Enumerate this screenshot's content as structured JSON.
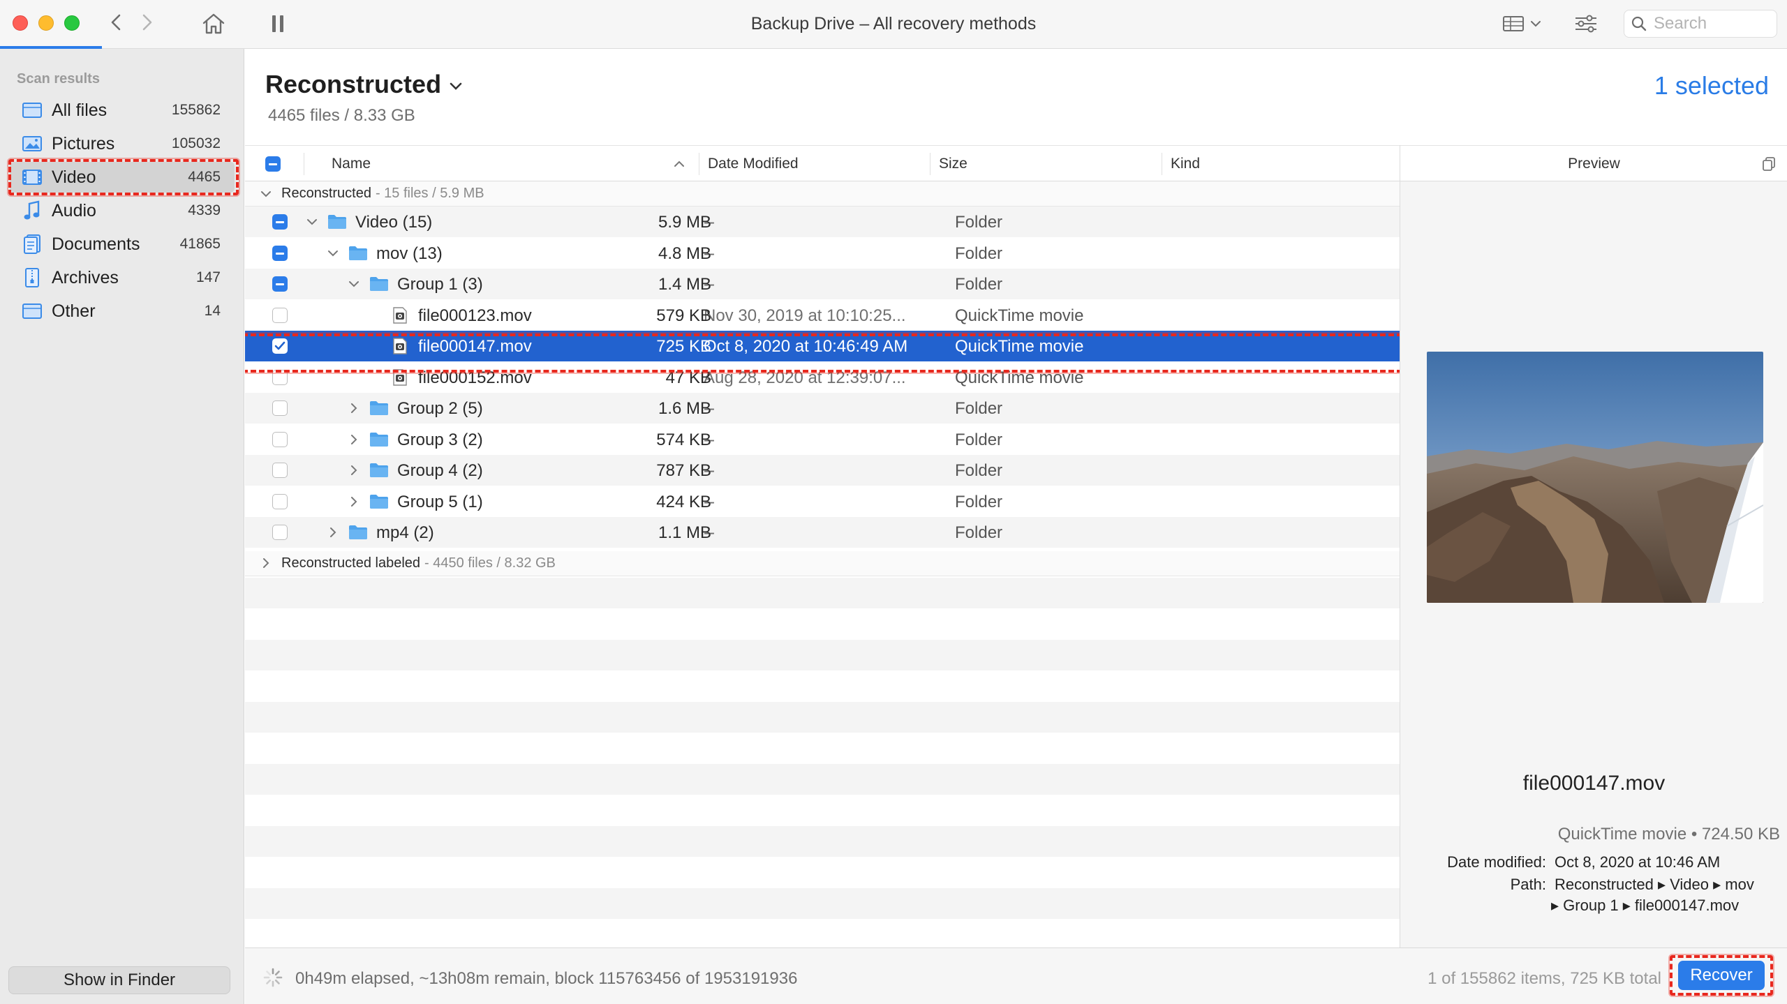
{
  "window": {
    "title": "Backup Drive – All recovery methods",
    "search_placeholder": "Search"
  },
  "sidebar": {
    "heading": "Scan results",
    "items": [
      {
        "label": "All files",
        "count": "155862",
        "icon": "all-files-icon"
      },
      {
        "label": "Pictures",
        "count": "105032",
        "icon": "pictures-icon"
      },
      {
        "label": "Video",
        "count": "4465",
        "icon": "video-icon",
        "active": true
      },
      {
        "label": "Audio",
        "count": "4339",
        "icon": "audio-icon"
      },
      {
        "label": "Documents",
        "count": "41865",
        "icon": "documents-icon"
      },
      {
        "label": "Archives",
        "count": "147",
        "icon": "archives-icon"
      },
      {
        "label": "Other",
        "count": "14",
        "icon": "other-icon"
      }
    ],
    "show_in_finder": "Show in Finder"
  },
  "main": {
    "title": "Reconstructed",
    "subtitle": "4465 files / 8.33 GB",
    "selected": "1 selected"
  },
  "table": {
    "columns": {
      "name": "Name",
      "date": "Date Modified",
      "size": "Size",
      "kind": "Kind"
    },
    "groups": [
      {
        "title": "Reconstructed",
        "meta": "- 15 files / 5.9 MB"
      },
      {
        "title": "Reconstructed labeled",
        "meta": "- 4450 files / 8.32 GB"
      }
    ],
    "rows": [
      {
        "name": "Video (15)",
        "date": "--",
        "size": "5.9 MB",
        "kind": "Folder",
        "type": "folder",
        "level": 0,
        "check": "mixed",
        "disclosure": "open"
      },
      {
        "name": "mov (13)",
        "date": "--",
        "size": "4.8 MB",
        "kind": "Folder",
        "type": "folder",
        "level": 1,
        "check": "mixed",
        "disclosure": "open"
      },
      {
        "name": "Group 1 (3)",
        "date": "--",
        "size": "1.4 MB",
        "kind": "Folder",
        "type": "folder",
        "level": 2,
        "check": "mixed",
        "disclosure": "open"
      },
      {
        "name": "file000123.mov",
        "date": "Nov 30, 2019 at 10:10:25...",
        "size": "579 KB",
        "kind": "QuickTime movie",
        "type": "file",
        "level": 3,
        "check": "none",
        "disclosure": "none"
      },
      {
        "name": "file000147.mov",
        "date": "Oct 8, 2020 at 10:46:49 AM",
        "size": "725 KB",
        "kind": "QuickTime movie",
        "type": "file",
        "level": 3,
        "check": "checked",
        "disclosure": "none",
        "selected": true
      },
      {
        "name": "file000152.mov",
        "date": "Aug 28, 2020 at 12:39:07...",
        "size": "47 KB",
        "kind": "QuickTime movie",
        "type": "file",
        "level": 3,
        "check": "none",
        "disclosure": "none"
      },
      {
        "name": "Group 2 (5)",
        "date": "--",
        "size": "1.6 MB",
        "kind": "Folder",
        "type": "folder",
        "level": 2,
        "check": "none",
        "disclosure": "closed"
      },
      {
        "name": "Group 3 (2)",
        "date": "--",
        "size": "574 KB",
        "kind": "Folder",
        "type": "folder",
        "level": 2,
        "check": "none",
        "disclosure": "closed"
      },
      {
        "name": "Group 4 (2)",
        "date": "--",
        "size": "787 KB",
        "kind": "Folder",
        "type": "folder",
        "level": 2,
        "check": "none",
        "disclosure": "closed"
      },
      {
        "name": "Group 5 (1)",
        "date": "--",
        "size": "424 KB",
        "kind": "Folder",
        "type": "folder",
        "level": 2,
        "check": "none",
        "disclosure": "closed"
      },
      {
        "name": "mp4 (2)",
        "date": "--",
        "size": "1.1 MB",
        "kind": "Folder",
        "type": "folder",
        "level": 1,
        "check": "none",
        "disclosure": "closed"
      }
    ]
  },
  "preview": {
    "header": "Preview",
    "filename": "file000147.mov",
    "kind_size": "QuickTime movie • 724.50 KB",
    "date_label": "Date modified:",
    "date_value": "Oct 8, 2020 at 10:46 AM",
    "path_label": "Path:",
    "path_line1": "Reconstructed ▸ Video ▸ mov",
    "path_line2": "▸ Group 1 ▸ file000147.mov"
  },
  "status": {
    "text": "0h49m elapsed, ~13h08m remain, block 115763456 of 1953191936",
    "items": "1 of 155862 items, 725 KB total",
    "recover": "Recover"
  },
  "colors": {
    "accent": "#2b7ce9",
    "selection": "#2262cf",
    "annotation": "#e8281e",
    "folder": "#4ea3ec"
  }
}
